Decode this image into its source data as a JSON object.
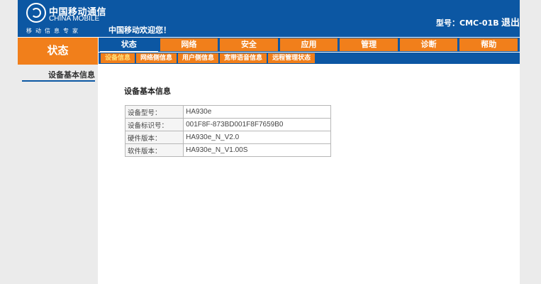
{
  "header": {
    "brand_cn": "中国移动通信",
    "brand_en": "CHINA MOBILE",
    "slogan": "移动信息专家",
    "welcome": "中国移动欢迎您！",
    "model_label": "型号：CMC-01B",
    "logout": "退出"
  },
  "status_block": {
    "label": "状态"
  },
  "nav": {
    "tabs": [
      {
        "label": "状态",
        "active": true
      },
      {
        "label": "网络"
      },
      {
        "label": "安全"
      },
      {
        "label": "应用"
      },
      {
        "label": "管理"
      },
      {
        "label": "诊断"
      },
      {
        "label": "帮助"
      }
    ]
  },
  "subnav": {
    "tabs": [
      {
        "label": "设备信息",
        "active": true
      },
      {
        "label": "网络侧信息"
      },
      {
        "label": "用户侧信息"
      },
      {
        "label": "宽带语音信息"
      },
      {
        "label": "远程管理状态"
      }
    ]
  },
  "sidebar": {
    "items": [
      {
        "label": "设备基本信息"
      }
    ]
  },
  "content": {
    "title": "设备基本信息",
    "rows": [
      {
        "key": "设备型号：",
        "value": "HA930e"
      },
      {
        "key": "设备标识号：",
        "value": "001F8F-873BD001F8F7659B0"
      },
      {
        "key": "硬件版本：",
        "value": "HA930e_N_V2.0"
      },
      {
        "key": "软件版本：",
        "value": "HA930e_N_V1.00S"
      }
    ]
  },
  "colors": {
    "brand_blue": "#0c57a3",
    "accent_orange": "#f17f1b"
  }
}
